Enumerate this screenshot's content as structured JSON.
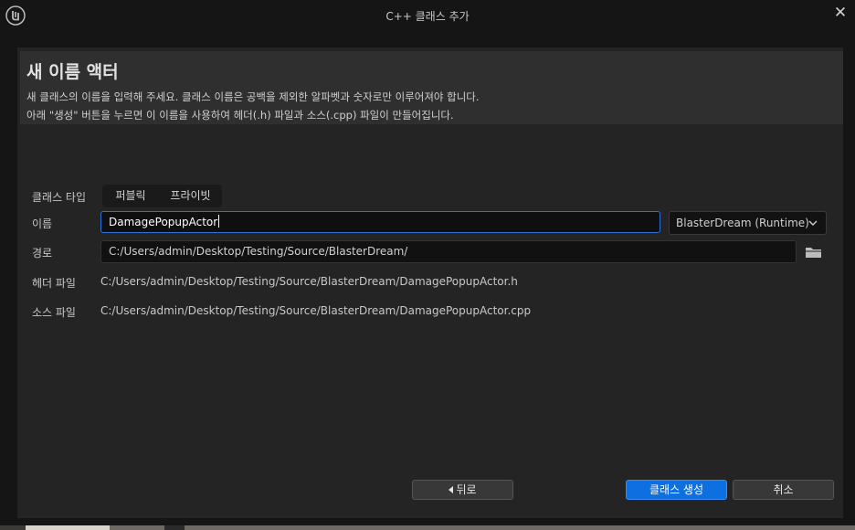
{
  "window": {
    "title": "C++ 클래스 추가",
    "close_glyph": "✕"
  },
  "header": {
    "title": "새 이름 액터",
    "description_line1": "새 클래스의 이름을 입력해 주세요. 클래스 이름은 공백을 제외한 알파벳과 숫자로만 이루어져야 합니다.",
    "description_line2": "아래 \"생성\" 버튼을 누르면 이 이름을 사용하여 헤더(.h) 파일과 소스(.cpp) 파일이 만들어집니다."
  },
  "form": {
    "class_type_label": "클래스 타입",
    "class_type_options": [
      "퍼블릭",
      "프라이빗"
    ],
    "name_label": "이름",
    "name_value": "DamagePopupActor",
    "module_value": "BlasterDream (Runtime)",
    "path_label": "경로",
    "path_value": "C:/Users/admin/Desktop/Testing/Source/BlasterDream/",
    "header_file_label": "헤더 파일",
    "header_file_value": "C:/Users/admin/Desktop/Testing/Source/BlasterDream/DamagePopupActor.h",
    "source_file_label": "소스 파일",
    "source_file_value": "C:/Users/admin/Desktop/Testing/Source/BlasterDream/DamagePopupActor.cpp"
  },
  "footer": {
    "back_label": "뒤로",
    "create_label": "클래스 생성",
    "cancel_label": "취소"
  },
  "icons": {
    "logo": "unreal-logo-icon",
    "close": "close-icon",
    "dropdown": "chevron-down-icon",
    "folder": "folder-icon",
    "back": "back-arrow-icon"
  },
  "colors": {
    "accent": "#0e70e0",
    "focus_border": "#2a72d6",
    "panel_bg": "#242424",
    "header_bg": "#2f2f2f",
    "window_bg": "#151515"
  }
}
